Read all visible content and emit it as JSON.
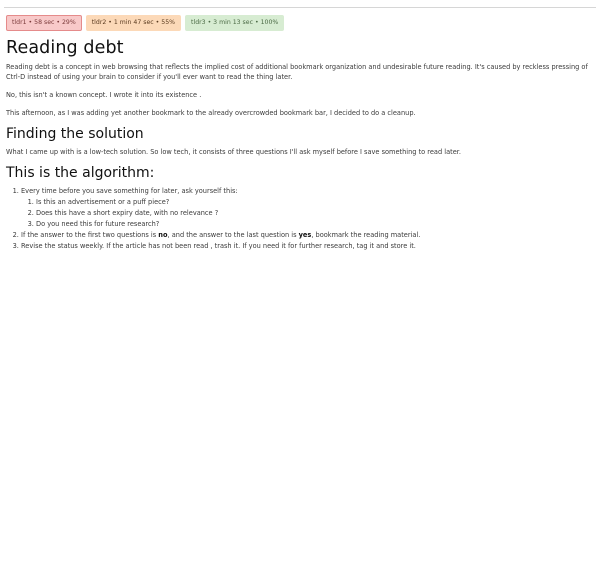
{
  "tabs": [
    {
      "label": "tldr1 • 58 sec • 29%"
    },
    {
      "label": "tldr2 • 1 min 47 sec • 55%"
    },
    {
      "label": "tldr3 • 3 min 13 sec • 100%"
    }
  ],
  "article": {
    "title": "Reading debt",
    "intro": "Reading debt is a concept in web browsing that reflects the implied cost of additional bookmark organization and undesirable future reading. It's caused by reckless pressing of Ctrl-D instead of using your brain to consider if you'll ever want to read the thing later.",
    "note": "No, this isn't a known concept. I wrote it into its existence .",
    "story": "This afternoon, as I was adding yet another bookmark to the already overcrowded bookmark bar, I decided to do a cleanup.",
    "solution_heading": "Finding the solution",
    "solution_text": "What I came up with is a low-tech solution. So low tech, it consists of three questions I'll ask myself before I save something to read later.",
    "algorithm_heading": "This is the algorithm:",
    "steps": {
      "step1": "Every time before you save something for later, ask yourself this:",
      "questions": [
        "Is this an advertisement or a puff piece?",
        "Does this have a short expiry date, with no relevance ?",
        "Do you need this for future research?"
      ],
      "step2_a": "If the answer to the first two questions is ",
      "step2_no": "no",
      "step2_b": ", and the answer to the last question is ",
      "step2_yes": "yes",
      "step2_c": ", bookmark the reading material.",
      "step3": "Revise the status weekly. If the article has not been read , trash it. If you need it for further research, tag it and store it."
    }
  }
}
